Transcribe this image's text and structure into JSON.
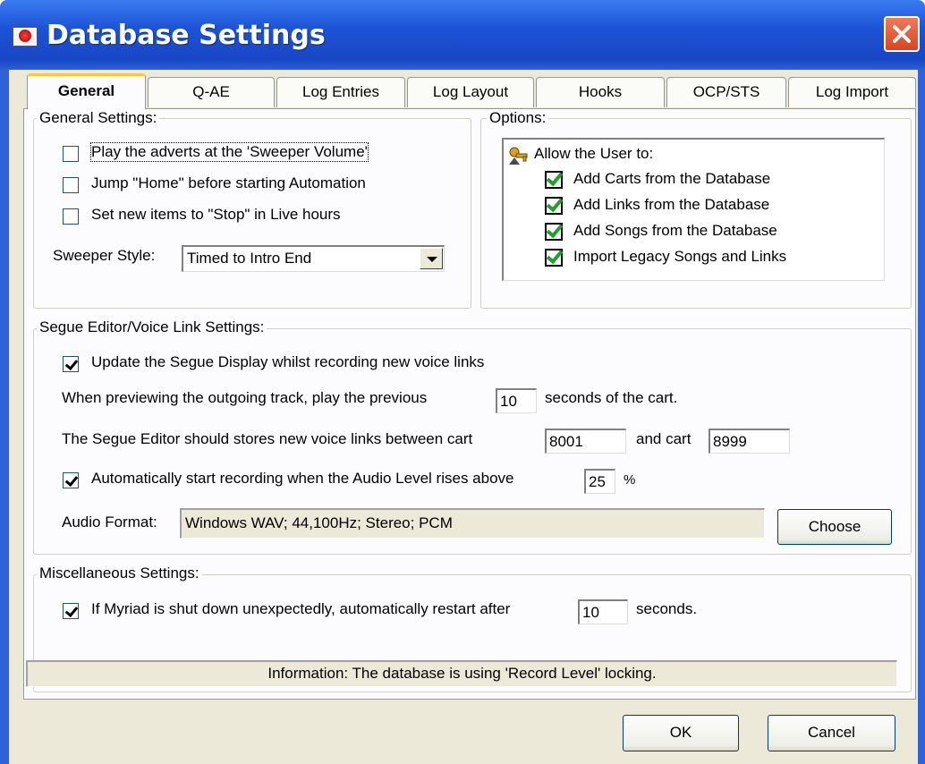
{
  "window": {
    "title": "Database Settings",
    "icon": "app-icon",
    "close_icon": "close-icon"
  },
  "tabs": [
    {
      "label": "General",
      "active": true
    },
    {
      "label": "Q-AE"
    },
    {
      "label": "Log Entries"
    },
    {
      "label": "Log Layout"
    },
    {
      "label": "Hooks"
    },
    {
      "label": "OCP/STS"
    },
    {
      "label": "Log Import"
    }
  ],
  "general_settings": {
    "title": "General Settings:",
    "items": [
      {
        "label": "Play the adverts at the 'Sweeper Volume'",
        "checked": false
      },
      {
        "label": "Jump \"Home\" before starting Automation",
        "checked": false
      },
      {
        "label": "Set new items to \"Stop\" in Live hours",
        "checked": false
      }
    ],
    "sweeper_label": "Sweeper Style:",
    "sweeper_value": "Timed to Intro End"
  },
  "options": {
    "title": "Options:",
    "root_label": "Allow the User to:",
    "items": [
      {
        "label": "Add Carts from the Database",
        "checked": true
      },
      {
        "label": "Add Links from the Database",
        "checked": true
      },
      {
        "label": "Add Songs from the Database",
        "checked": true
      },
      {
        "label": "Import Legacy Songs and Links",
        "checked": true
      }
    ]
  },
  "segue": {
    "title": "Segue Editor/Voice Link Settings:",
    "update_display_label": "Update the Segue Display whilst recording new voice links",
    "update_display_checked": true,
    "preview_prefix": "When previewing the outgoing  track, play the previous",
    "preview_value": "10",
    "preview_suffix": "seconds of the cart.",
    "store_prefix": "The Segue Editor should stores new voice links between cart",
    "cart_from": "8001",
    "store_mid": "and cart",
    "cart_to": "8999",
    "auto_record_label": "Automatically start recording when the Audio Level rises above",
    "auto_record_checked": true,
    "audio_level": "25",
    "audio_level_unit": "%",
    "audio_format_label": "Audio Format:",
    "audio_format_value": "Windows WAV; 44,100Hz; Stereo; PCM",
    "choose_label": "Choose"
  },
  "misc": {
    "title": "Miscellaneous Settings:",
    "restart_label": "If Myriad is shut down unexpectedly, automatically restart after",
    "restart_checked": true,
    "restart_value": "10",
    "restart_suffix": "seconds."
  },
  "status": "Information: The database is using 'Record Level' locking.",
  "buttons": {
    "ok": "OK",
    "cancel": "Cancel"
  }
}
